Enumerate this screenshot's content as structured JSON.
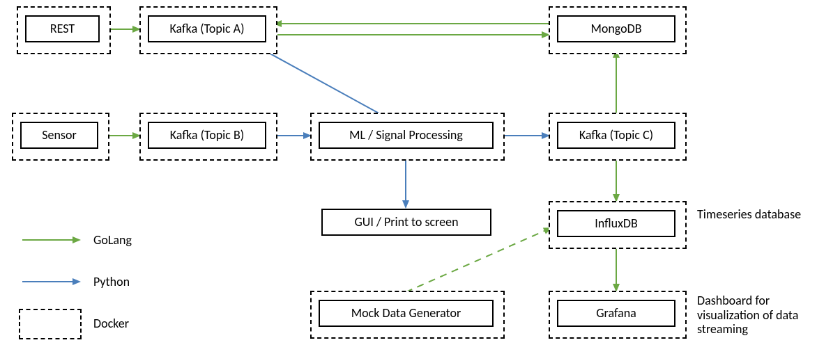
{
  "colors": {
    "green": "#6BA843",
    "blue": "#4A7EBB",
    "black": "#000000"
  },
  "nodes": {
    "rest": "REST",
    "kafka_a": "Kafka (Topic A)",
    "sensor": "Sensor",
    "kafka_b": "Kafka (Topic B)",
    "ml": "ML / Signal Processing",
    "gui": "GUI / Print to screen",
    "mock": "Mock Data Generator",
    "kafka_c": "Kafka (Topic C)",
    "mongodb": "MongoDB",
    "influxdb": "InfluxDB",
    "grafana": "Grafana"
  },
  "annotations": {
    "influx_note": "Timeseries database",
    "grafana_note": "Dashboard for visualization of data streaming"
  },
  "legend": {
    "golang": "GoLang",
    "python": "Python",
    "docker": "Docker"
  },
  "chart_data": {
    "type": "diagram",
    "nodes": [
      {
        "id": "rest",
        "label": "REST",
        "docker": true
      },
      {
        "id": "kafka_a",
        "label": "Kafka (Topic A)",
        "docker": true
      },
      {
        "id": "sensor",
        "label": "Sensor",
        "docker": true
      },
      {
        "id": "kafka_b",
        "label": "Kafka (Topic B)",
        "docker": true
      },
      {
        "id": "ml",
        "label": "ML / Signal Processing",
        "docker": true
      },
      {
        "id": "gui",
        "label": "GUI / Print to screen",
        "docker": false
      },
      {
        "id": "mock",
        "label": "Mock Data Generator",
        "docker": true
      },
      {
        "id": "kafka_c",
        "label": "Kafka (Topic C)",
        "docker": true
      },
      {
        "id": "mongodb",
        "label": "MongoDB",
        "docker": true
      },
      {
        "id": "influxdb",
        "label": "InfluxDB",
        "docker": true
      },
      {
        "id": "grafana",
        "label": "Grafana",
        "docker": true
      }
    ],
    "edges": [
      {
        "from": "rest",
        "to": "kafka_a",
        "lang": "GoLang",
        "style": "solid"
      },
      {
        "from": "kafka_a",
        "to": "mongodb",
        "lang": "GoLang",
        "style": "solid"
      },
      {
        "from": "mongodb",
        "to": "kafka_a",
        "lang": "GoLang",
        "style": "solid"
      },
      {
        "from": "kafka_a",
        "to": "ml",
        "lang": "Python",
        "style": "solid"
      },
      {
        "from": "sensor",
        "to": "kafka_b",
        "lang": "GoLang",
        "style": "solid"
      },
      {
        "from": "kafka_b",
        "to": "ml",
        "lang": "Python",
        "style": "solid"
      },
      {
        "from": "ml",
        "to": "kafka_c",
        "lang": "Python",
        "style": "solid"
      },
      {
        "from": "ml",
        "to": "gui",
        "lang": "Python",
        "style": "solid"
      },
      {
        "from": "kafka_c",
        "to": "mongodb",
        "lang": "GoLang",
        "style": "solid"
      },
      {
        "from": "kafka_c",
        "to": "influxdb",
        "lang": "GoLang",
        "style": "solid"
      },
      {
        "from": "influxdb",
        "to": "grafana",
        "lang": "GoLang",
        "style": "solid"
      },
      {
        "from": "mock",
        "to": "influxdb",
        "lang": "GoLang",
        "style": "dashed"
      }
    ],
    "legend": [
      {
        "symbol": "green-arrow",
        "label": "GoLang"
      },
      {
        "symbol": "blue-arrow",
        "label": "Python"
      },
      {
        "symbol": "dashed-box",
        "label": "Docker"
      }
    ],
    "annotations": [
      {
        "target": "influxdb",
        "text": "Timeseries database"
      },
      {
        "target": "grafana",
        "text": "Dashboard for visualization of data streaming"
      }
    ]
  }
}
